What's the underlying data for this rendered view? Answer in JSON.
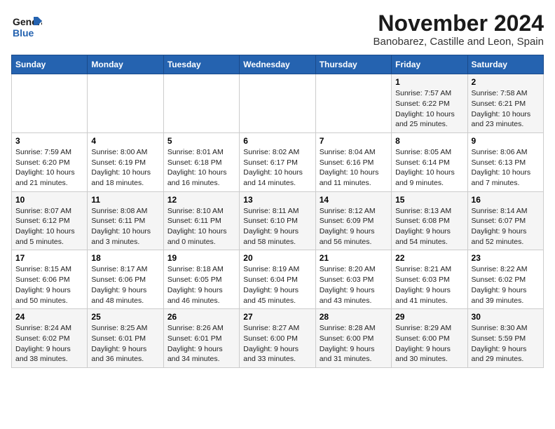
{
  "header": {
    "logo_line1": "General",
    "logo_line2": "Blue",
    "title": "November 2024",
    "subtitle": "Banobarez, Castille and Leon, Spain"
  },
  "weekdays": [
    "Sunday",
    "Monday",
    "Tuesday",
    "Wednesday",
    "Thursday",
    "Friday",
    "Saturday"
  ],
  "weeks": [
    [
      {
        "day": "",
        "info": ""
      },
      {
        "day": "",
        "info": ""
      },
      {
        "day": "",
        "info": ""
      },
      {
        "day": "",
        "info": ""
      },
      {
        "day": "",
        "info": ""
      },
      {
        "day": "1",
        "info": "Sunrise: 7:57 AM\nSunset: 6:22 PM\nDaylight: 10 hours and 25 minutes."
      },
      {
        "day": "2",
        "info": "Sunrise: 7:58 AM\nSunset: 6:21 PM\nDaylight: 10 hours and 23 minutes."
      }
    ],
    [
      {
        "day": "3",
        "info": "Sunrise: 7:59 AM\nSunset: 6:20 PM\nDaylight: 10 hours and 21 minutes."
      },
      {
        "day": "4",
        "info": "Sunrise: 8:00 AM\nSunset: 6:19 PM\nDaylight: 10 hours and 18 minutes."
      },
      {
        "day": "5",
        "info": "Sunrise: 8:01 AM\nSunset: 6:18 PM\nDaylight: 10 hours and 16 minutes."
      },
      {
        "day": "6",
        "info": "Sunrise: 8:02 AM\nSunset: 6:17 PM\nDaylight: 10 hours and 14 minutes."
      },
      {
        "day": "7",
        "info": "Sunrise: 8:04 AM\nSunset: 6:16 PM\nDaylight: 10 hours and 11 minutes."
      },
      {
        "day": "8",
        "info": "Sunrise: 8:05 AM\nSunset: 6:14 PM\nDaylight: 10 hours and 9 minutes."
      },
      {
        "day": "9",
        "info": "Sunrise: 8:06 AM\nSunset: 6:13 PM\nDaylight: 10 hours and 7 minutes."
      }
    ],
    [
      {
        "day": "10",
        "info": "Sunrise: 8:07 AM\nSunset: 6:12 PM\nDaylight: 10 hours and 5 minutes."
      },
      {
        "day": "11",
        "info": "Sunrise: 8:08 AM\nSunset: 6:11 PM\nDaylight: 10 hours and 3 minutes."
      },
      {
        "day": "12",
        "info": "Sunrise: 8:10 AM\nSunset: 6:11 PM\nDaylight: 10 hours and 0 minutes."
      },
      {
        "day": "13",
        "info": "Sunrise: 8:11 AM\nSunset: 6:10 PM\nDaylight: 9 hours and 58 minutes."
      },
      {
        "day": "14",
        "info": "Sunrise: 8:12 AM\nSunset: 6:09 PM\nDaylight: 9 hours and 56 minutes."
      },
      {
        "day": "15",
        "info": "Sunrise: 8:13 AM\nSunset: 6:08 PM\nDaylight: 9 hours and 54 minutes."
      },
      {
        "day": "16",
        "info": "Sunrise: 8:14 AM\nSunset: 6:07 PM\nDaylight: 9 hours and 52 minutes."
      }
    ],
    [
      {
        "day": "17",
        "info": "Sunrise: 8:15 AM\nSunset: 6:06 PM\nDaylight: 9 hours and 50 minutes."
      },
      {
        "day": "18",
        "info": "Sunrise: 8:17 AM\nSunset: 6:06 PM\nDaylight: 9 hours and 48 minutes."
      },
      {
        "day": "19",
        "info": "Sunrise: 8:18 AM\nSunset: 6:05 PM\nDaylight: 9 hours and 46 minutes."
      },
      {
        "day": "20",
        "info": "Sunrise: 8:19 AM\nSunset: 6:04 PM\nDaylight: 9 hours and 45 minutes."
      },
      {
        "day": "21",
        "info": "Sunrise: 8:20 AM\nSunset: 6:03 PM\nDaylight: 9 hours and 43 minutes."
      },
      {
        "day": "22",
        "info": "Sunrise: 8:21 AM\nSunset: 6:03 PM\nDaylight: 9 hours and 41 minutes."
      },
      {
        "day": "23",
        "info": "Sunrise: 8:22 AM\nSunset: 6:02 PM\nDaylight: 9 hours and 39 minutes."
      }
    ],
    [
      {
        "day": "24",
        "info": "Sunrise: 8:24 AM\nSunset: 6:02 PM\nDaylight: 9 hours and 38 minutes."
      },
      {
        "day": "25",
        "info": "Sunrise: 8:25 AM\nSunset: 6:01 PM\nDaylight: 9 hours and 36 minutes."
      },
      {
        "day": "26",
        "info": "Sunrise: 8:26 AM\nSunset: 6:01 PM\nDaylight: 9 hours and 34 minutes."
      },
      {
        "day": "27",
        "info": "Sunrise: 8:27 AM\nSunset: 6:00 PM\nDaylight: 9 hours and 33 minutes."
      },
      {
        "day": "28",
        "info": "Sunrise: 8:28 AM\nSunset: 6:00 PM\nDaylight: 9 hours and 31 minutes."
      },
      {
        "day": "29",
        "info": "Sunrise: 8:29 AM\nSunset: 6:00 PM\nDaylight: 9 hours and 30 minutes."
      },
      {
        "day": "30",
        "info": "Sunrise: 8:30 AM\nSunset: 5:59 PM\nDaylight: 9 hours and 29 minutes."
      }
    ]
  ]
}
